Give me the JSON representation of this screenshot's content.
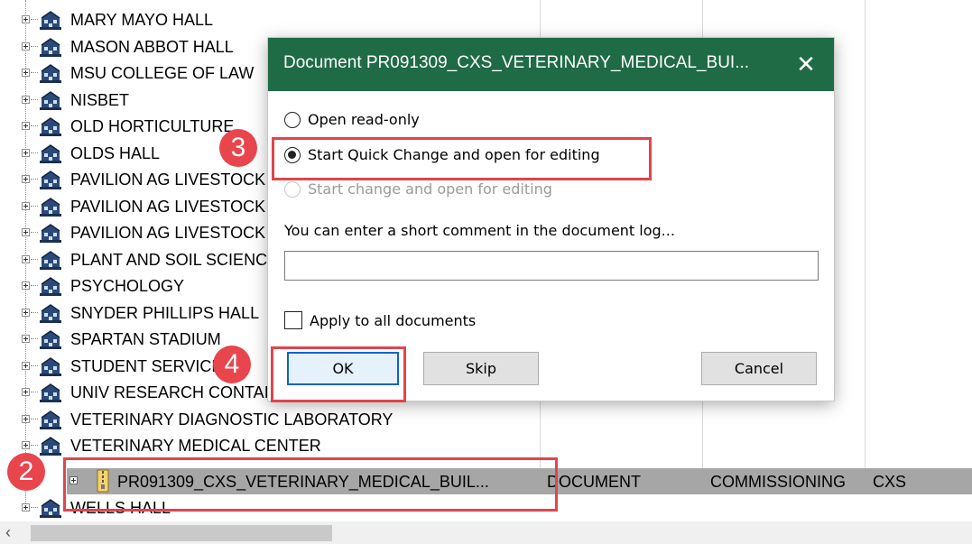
{
  "tree": {
    "rows": [
      {
        "label": "MARY MAYO HALL"
      },
      {
        "label": "MASON ABBOT HALL"
      },
      {
        "label": "MSU COLLEGE OF LAW"
      },
      {
        "label": "NISBET"
      },
      {
        "label": "OLD HORTICULTURE"
      },
      {
        "label": "OLDS HALL"
      },
      {
        "label": "PAVILION AG  LIVESTOCK"
      },
      {
        "label": "PAVILION AG LIVESTOCK"
      },
      {
        "label": "PAVILION AG LIVESTOCK"
      },
      {
        "label": "PLANT AND SOIL SCIENCES"
      },
      {
        "label": "PSYCHOLOGY"
      },
      {
        "label": "SNYDER PHILLIPS HALL"
      },
      {
        "label": "SPARTAN STADIUM"
      },
      {
        "label": "STUDENT SERVICES"
      },
      {
        "label": "UNIV RESEARCH CONTAINMENT"
      },
      {
        "label": "VETERINARY DIAGNOSTIC LABORATORY"
      },
      {
        "label": "VETERINARY MEDICAL CENTER"
      }
    ],
    "document_row": {
      "name": "PR091309_CXS_VETERINARY_MEDICAL_BUIL...",
      "type": "DOCUMENT",
      "category": "COMMISSIONING",
      "code": "CXS"
    },
    "last_row": {
      "label": "WELLS HALL"
    },
    "icon": "building-icon",
    "document_icon": "zip-file-icon"
  },
  "dialog": {
    "title": "Document PR091309_CXS_VETERINARY_MEDICAL_BUI...",
    "close": "✕",
    "options": [
      {
        "label": "Open read-only",
        "checked": false,
        "enabled": true
      },
      {
        "label": "Start Quick Change and open for editing",
        "checked": true,
        "enabled": true
      },
      {
        "label": "Start change and open for editing",
        "checked": false,
        "enabled": false
      }
    ],
    "comment_label": "You can enter a short comment in the document log...",
    "comment_value": "",
    "apply_all_label": "Apply to all documents",
    "apply_all_checked": false,
    "buttons": {
      "ok": "OK",
      "skip": "Skip",
      "cancel": "Cancel"
    },
    "title_bar_color": "#1e6b46"
  },
  "annotations": {
    "step2": "2",
    "step3": "3",
    "step4": "4",
    "color": "#e0454d"
  },
  "scrollbar": {
    "left_arrow": "‹"
  }
}
